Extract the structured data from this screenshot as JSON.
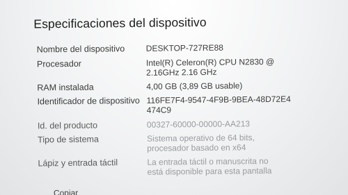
{
  "section_title": "Especificaciones del dispositivo",
  "specs": [
    {
      "label": "Nombre del dispositivo",
      "value": [
        "DESKTOP-727RE88"
      ]
    },
    {
      "label": "Procesador",
      "value": [
        "Intel(R) Celeron(R) CPU  N2830  @",
        "2.16GHz   2.16 GHz"
      ]
    },
    {
      "label": "RAM instalada",
      "value": [
        "4,00 GB (3,89 GB usable)"
      ]
    },
    {
      "label": "Identificador de dispositivo",
      "value": [
        "116FE7F4-9547-4F9B-9BEA-48D72E4",
        "474C9"
      ]
    },
    {
      "label": "Id. del producto",
      "value": [
        "00327-60000-00000-AA213"
      ]
    },
    {
      "label": "Tipo de sistema",
      "value": [
        "Sistema operativo de 64 bits,",
        "procesador basado en x64"
      ]
    },
    {
      "label": "Lápiz y entrada táctil",
      "value": [
        "La entrada táctil o manuscrita no",
        "está disponible para esta pantalla"
      ]
    }
  ],
  "copy_button": "Copiar"
}
